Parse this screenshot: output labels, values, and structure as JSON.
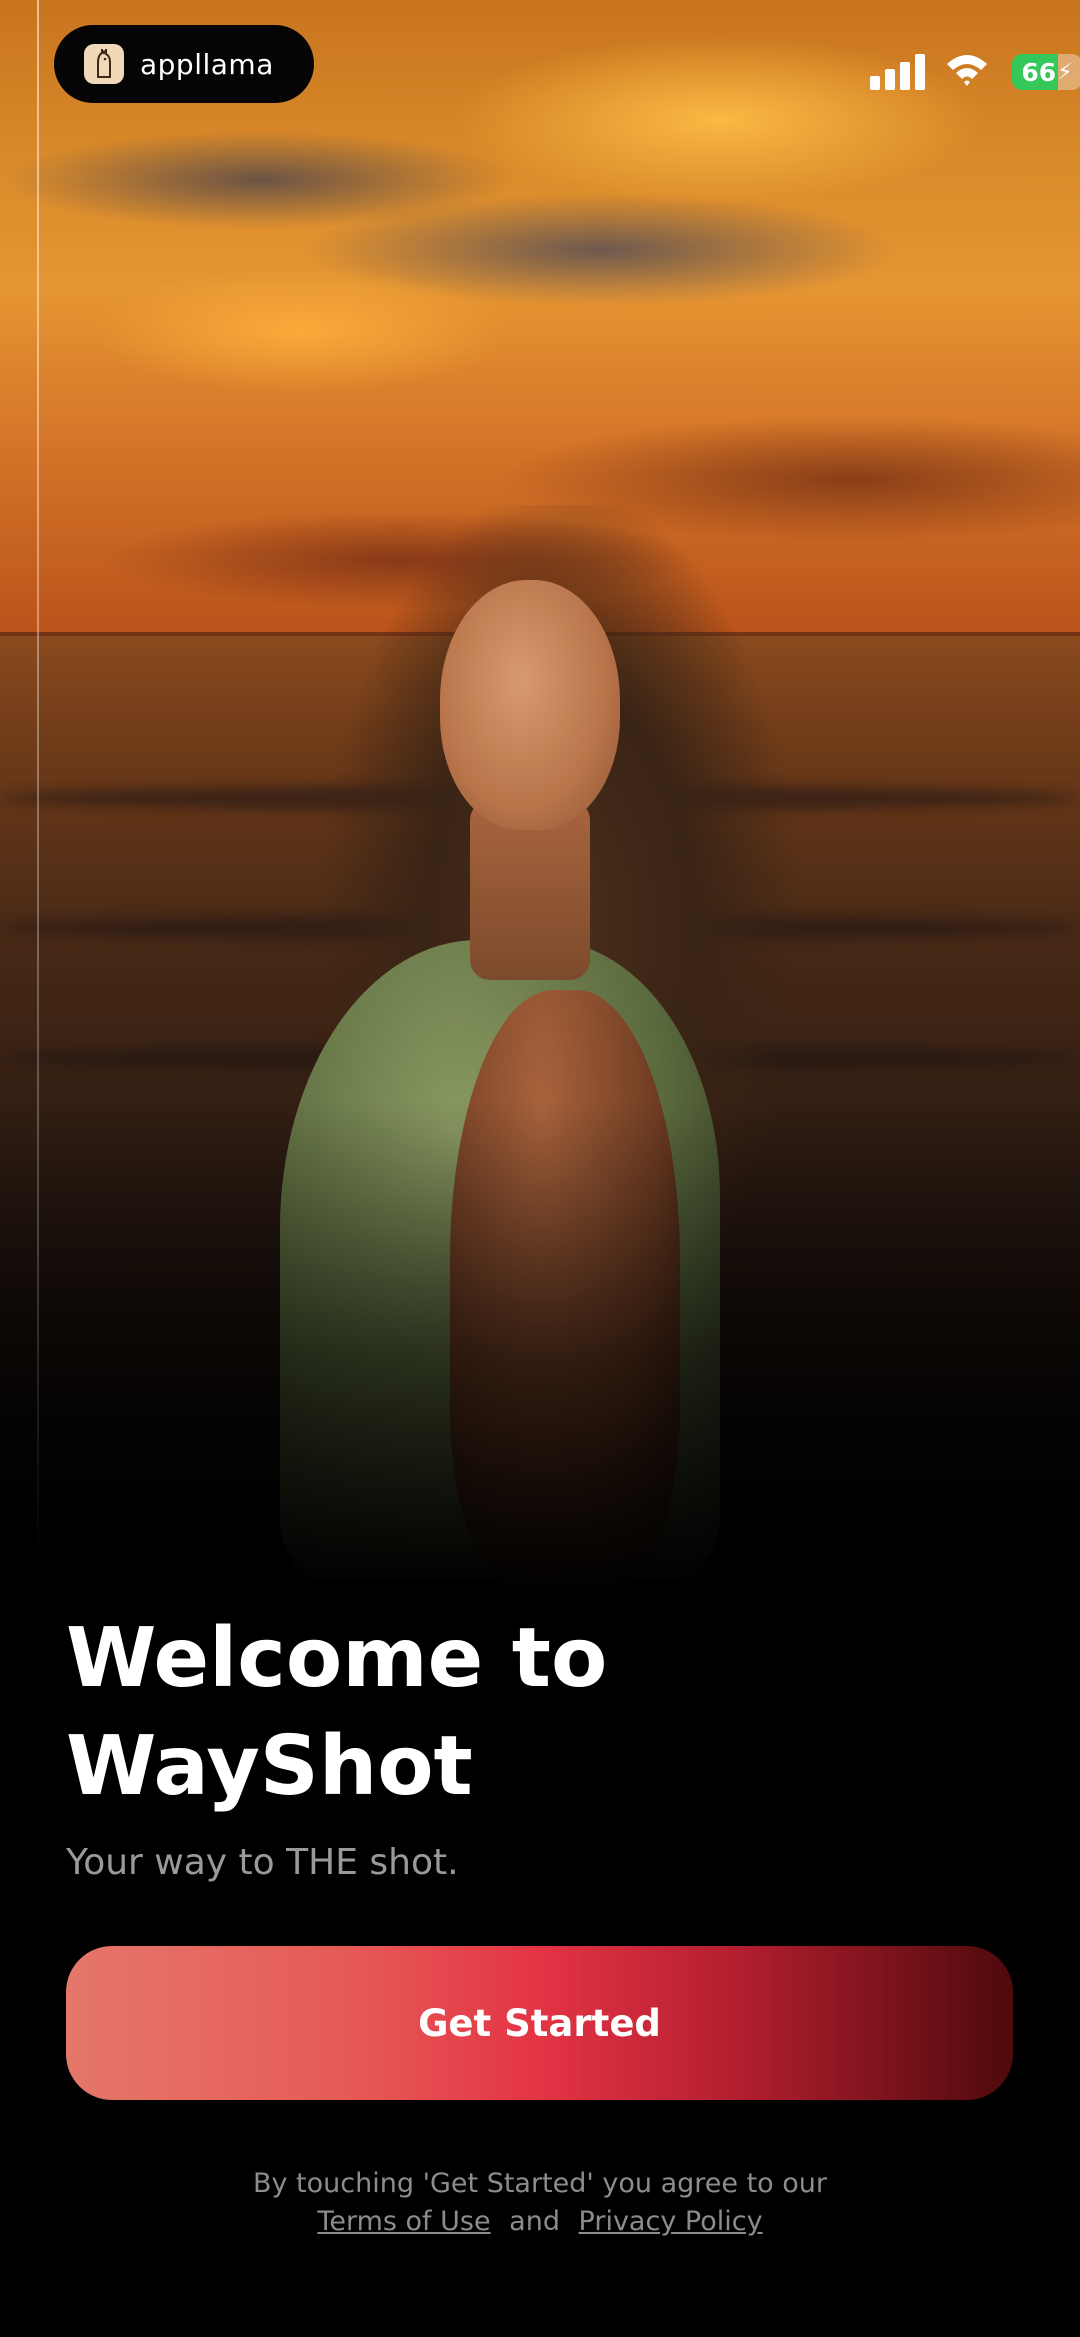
{
  "status_bar": {
    "app_badge_label": "appllama",
    "app_badge_icon": "llama-icon",
    "battery_level": "66",
    "battery_color": "#34c759",
    "signal_icon": "cellular-signal-icon",
    "wifi_icon": "wifi-icon"
  },
  "hero": {
    "title": "Welcome to WayShot",
    "subtitle": "Your way to THE shot."
  },
  "cta": {
    "label": "Get Started",
    "gradient_colors": [
      "#e5776a",
      "#e33444",
      "#4d0a0c"
    ]
  },
  "legal": {
    "prefix": "By touching 'Get Started' you agree to our",
    "terms_label": "Terms of Use",
    "connector": "and",
    "privacy_label": "Privacy Policy"
  }
}
